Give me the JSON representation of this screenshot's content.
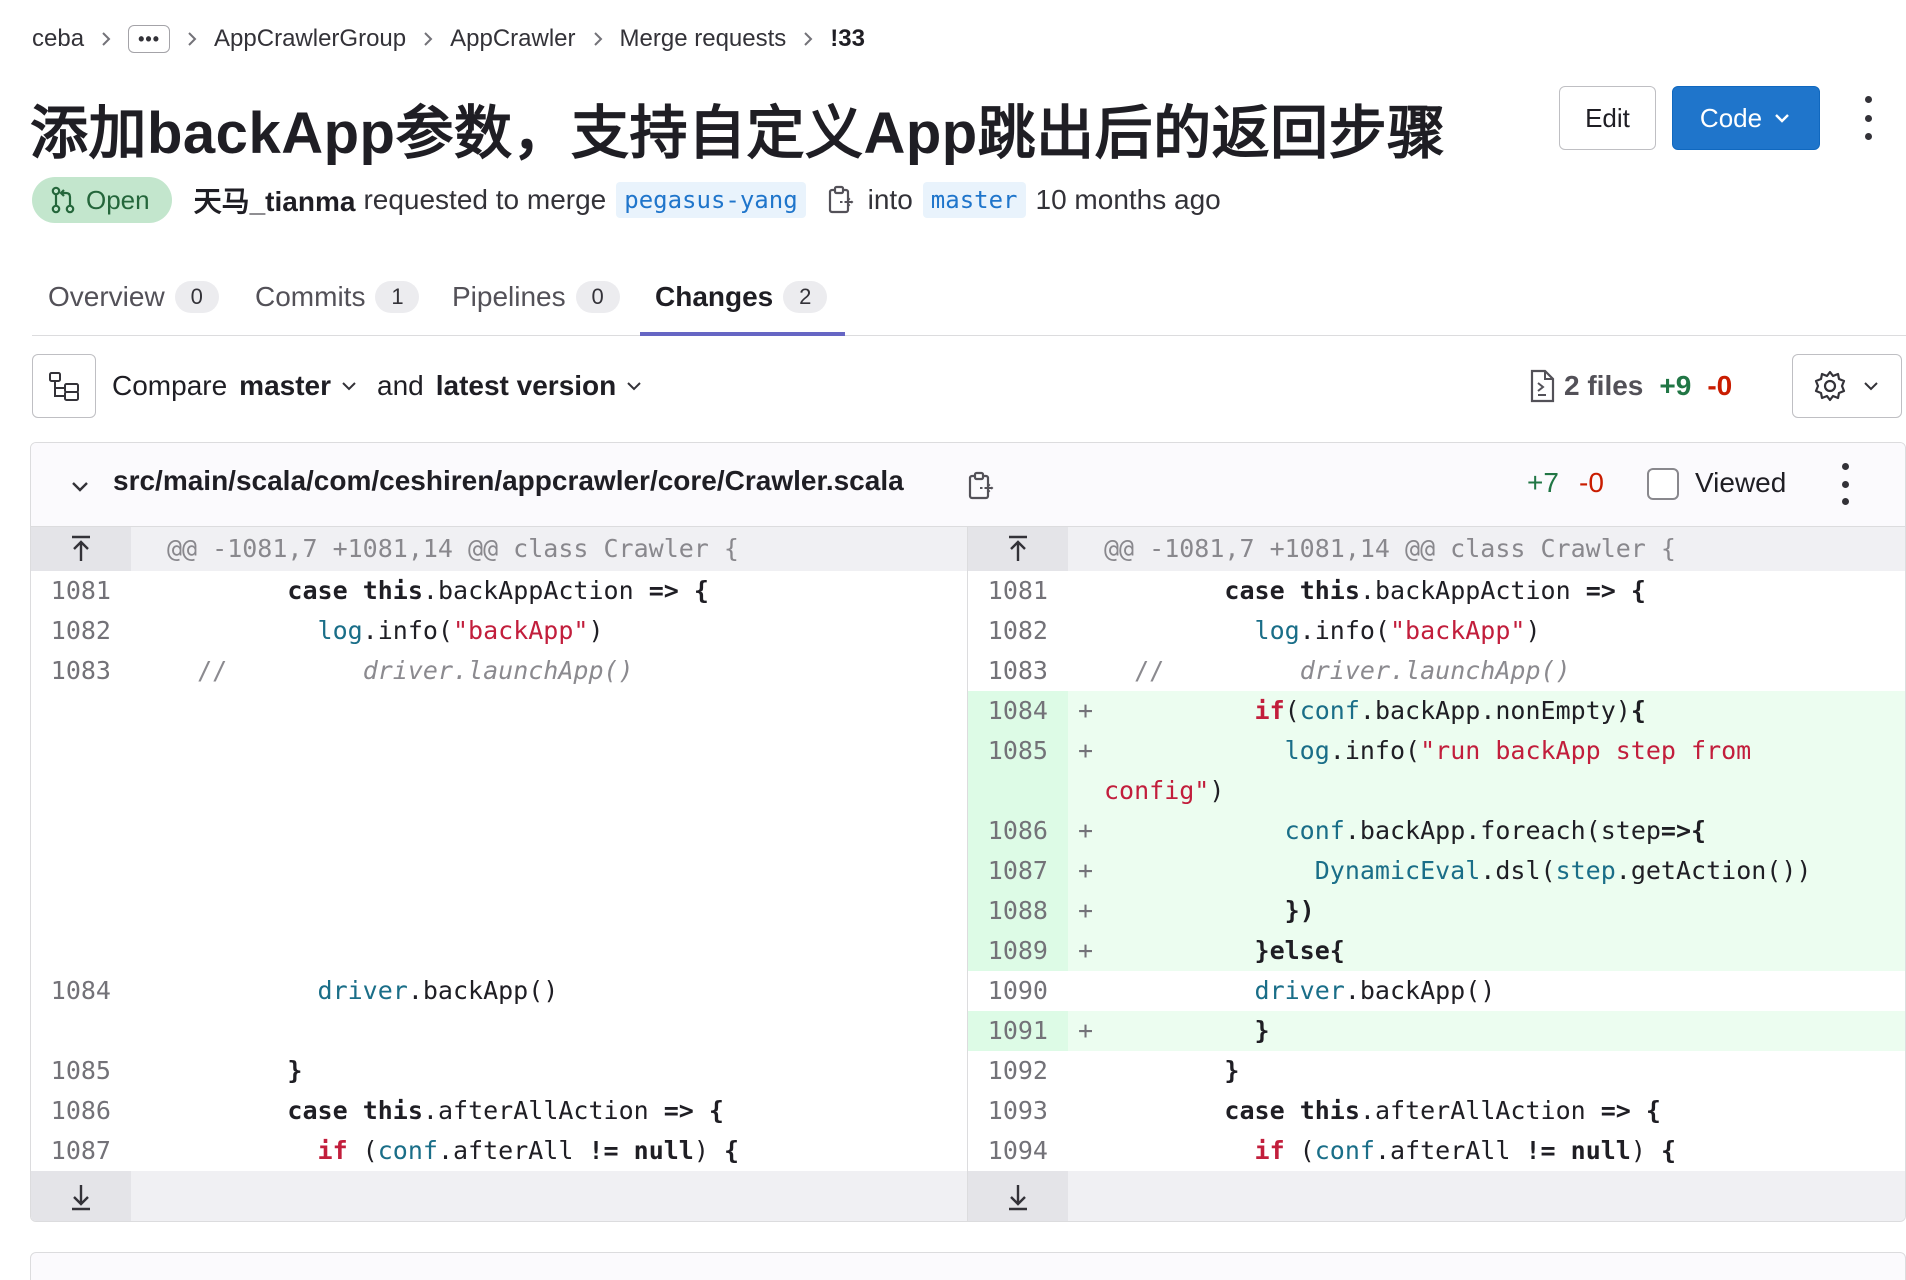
{
  "breadcrumb": {
    "items": [
      "ceba",
      "•••",
      "AppCrawlerGroup",
      "AppCrawler",
      "Merge requests",
      "!33"
    ]
  },
  "mr": {
    "title": "添加backApp参数，支持自定义App跳出后的返回步骤",
    "status": "Open",
    "author": "天马_tianma",
    "requested_text": "requested to merge",
    "source_branch": "pegasus-yang",
    "into_text": "into",
    "target_branch": "master",
    "time_ago": "10 months ago"
  },
  "actions": {
    "edit_label": "Edit",
    "code_label": "Code"
  },
  "tabs": [
    {
      "label": "Overview",
      "count": "0"
    },
    {
      "label": "Commits",
      "count": "1"
    },
    {
      "label": "Pipelines",
      "count": "0"
    },
    {
      "label": "Changes",
      "count": "2",
      "active": true
    }
  ],
  "toolbar": {
    "compare_label": "Compare",
    "base_version": "master",
    "and_label": "and",
    "head_version": "latest version",
    "files_count": "2 files",
    "additions": "+9",
    "deletions": "-0"
  },
  "file": {
    "path": "src/main/scala/com/ceshiren/appcrawler/core/Crawler.scala",
    "additions": "+7",
    "deletions": "-0",
    "viewed_label": "Viewed",
    "hunk_header": "@@ -1081,7 +1081,14 @@ class Crawler {",
    "left_line_numbers": [
      "1081",
      "1082",
      "1083",
      "1084",
      "1085",
      "1086",
      "1087"
    ],
    "right_line_numbers": [
      "1081",
      "1082",
      "1083",
      "1084",
      "1085",
      "1086",
      "1087",
      "1088",
      "1089",
      "1090",
      "1091",
      "1092",
      "1093",
      "1094"
    ],
    "added_marker": "+"
  },
  "colors": {
    "accent_blue": "#1f75cb",
    "open_badge_bg": "#c3e6cd",
    "open_badge_text": "#24663b",
    "addition_green": "#217645",
    "deletion_red": "#c91c00",
    "added_line_bg": "#ecfdf0",
    "active_tab_underline": "#6666c4"
  },
  "icons": {
    "more": "ellipsis-icon",
    "status": "merge-request-icon",
    "copy": "clipboard-icon",
    "tree": "file-tree-icon",
    "diff_file": "diff-file-icon",
    "settings": "gear-icon",
    "collapse": "chevron-down-icon",
    "expand_up": "expand-up-icon",
    "expand_down": "expand-down-icon"
  }
}
